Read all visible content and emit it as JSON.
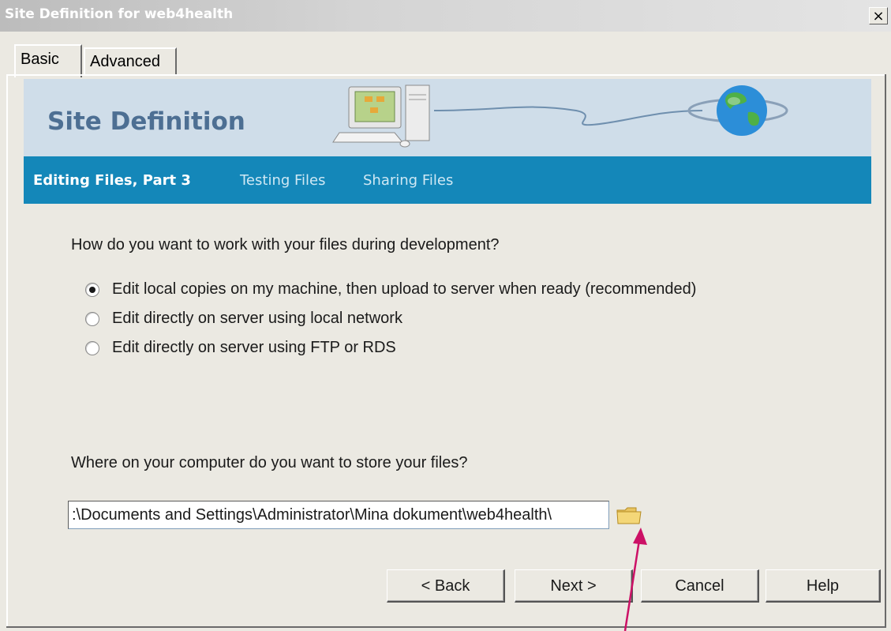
{
  "window": {
    "title": "Site Definition for web4health",
    "close_glyph": "×"
  },
  "tabs": [
    {
      "label": "Basic",
      "active": true
    },
    {
      "label": "Advanced",
      "active": false
    }
  ],
  "banner": {
    "title": "Site Definition"
  },
  "steps": [
    {
      "label": "Editing Files, Part 3",
      "active": true
    },
    {
      "label": "Testing Files",
      "active": false
    },
    {
      "label": "Sharing Files",
      "active": false
    }
  ],
  "work_mode": {
    "question": "How do you want to work with your files during development?",
    "options": [
      {
        "label": "Edit local copies on my machine, then upload to server when ready (recommended)",
        "selected": true
      },
      {
        "label": "Edit directly on server using local network",
        "selected": false
      },
      {
        "label": "Edit directly on server using FTP or RDS",
        "selected": false
      }
    ]
  },
  "storage": {
    "question": "Where on your computer do you want to store your files?",
    "path_value": ":\\Documents and Settings\\Administrator\\Mina dokument\\web4health\\",
    "browse_icon": "folder-icon"
  },
  "buttons": {
    "back": "< Back",
    "next": "Next >",
    "cancel": "Cancel",
    "help": "Help"
  },
  "colors": {
    "step_bar": "#1487b9",
    "banner_bg": "#cfdde9",
    "banner_title": "#4d6f93",
    "annotation_arrow": "#cc1166"
  }
}
